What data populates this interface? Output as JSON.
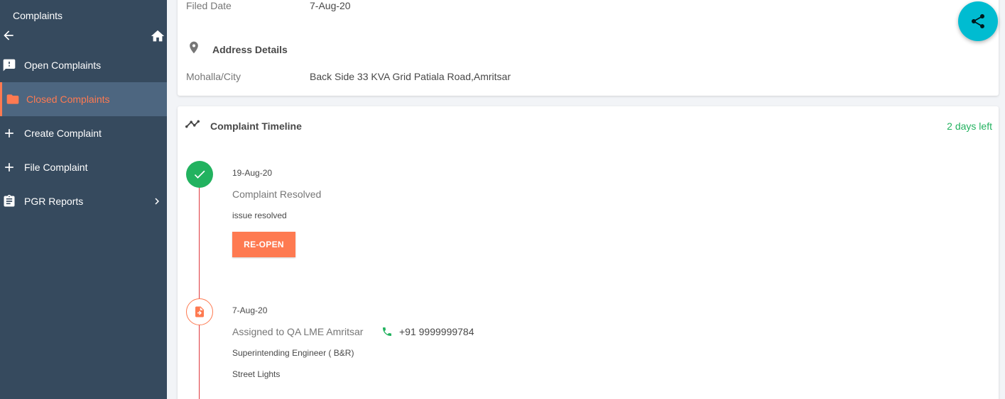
{
  "sidebar": {
    "title": "Complaints",
    "items": [
      {
        "label": "Open Complaints",
        "icon": "feedback-icon"
      },
      {
        "label": "Closed Complaints",
        "icon": "folder-icon",
        "active": true
      },
      {
        "label": "Create Complaint",
        "icon": "plus-icon"
      },
      {
        "label": "File Complaint",
        "icon": "plus-icon"
      },
      {
        "label": "PGR Reports",
        "icon": "clipboard-icon"
      }
    ]
  },
  "details": {
    "filed_date_label": "Filed Date",
    "filed_date_value": "7-Aug-20",
    "address_heading": "Address Details",
    "city_label": "Mohalla/City",
    "city_value": "Back Side 33 KVA Grid Patiala Road,Amritsar"
  },
  "timeline": {
    "heading": "Complaint Timeline",
    "days_left": "2 days left",
    "entries": [
      {
        "date": "19-Aug-20",
        "status": "Complaint Resolved",
        "comment": "issue resolved",
        "button": "RE-OPEN"
      },
      {
        "date": "7-Aug-20",
        "status": "Assigned to QA LME Amritsar",
        "phone": "+91 9999999784",
        "designation": "Superintending Engineer ( B&R)",
        "department": "Street Lights"
      }
    ]
  },
  "colors": {
    "sidebar_bg": "#364a5e",
    "accent": "#fe7a51",
    "success": "#22b25f",
    "fab": "#00bcd1"
  }
}
